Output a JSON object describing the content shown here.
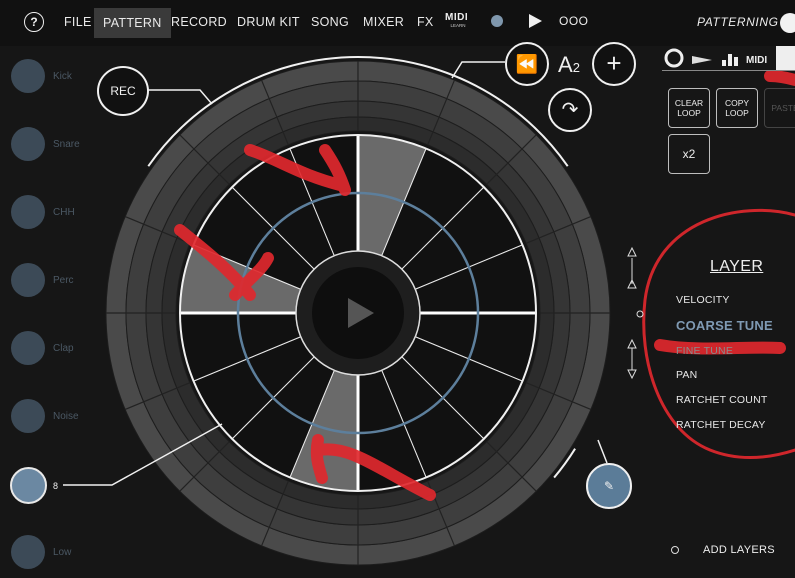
{
  "topbar": {
    "help": "?",
    "menu": [
      "FILE",
      "PATTERN",
      "RECORD",
      "DRUM KIT",
      "SONG",
      "MIXER",
      "FX"
    ],
    "active_menu": "PATTERN",
    "midi_learn_label": "MIDI",
    "midi_learn_sub": "LEARN",
    "more_label": "OOO",
    "app_title": "PATTERNING 2"
  },
  "drums": [
    {
      "label": "Kick"
    },
    {
      "label": "Snare"
    },
    {
      "label": "CHH"
    },
    {
      "label": "Perc"
    },
    {
      "label": "Clap"
    },
    {
      "label": "Noise"
    },
    {
      "label": ""
    },
    {
      "label": "Low"
    }
  ],
  "selected_drum_value": "8",
  "sequencer": {
    "rec_label": "REC",
    "pattern_name": "A",
    "pattern_sub": "2",
    "active_steps": [
      0,
      8,
      12
    ],
    "highlight_step": 11
  },
  "right_panel": {
    "clear_loop": "CLEAR LOOP",
    "copy_loop": "COPY LOOP",
    "paste": "PASTE",
    "x2": "x2",
    "layer_title": "LAYER",
    "layers": [
      "VELOCITY",
      "COARSE TUNE",
      "FINE TUNE",
      "PAN",
      "RATCHET COUNT",
      "RATCHET DECAY"
    ],
    "selected_layer": "COARSE TUNE",
    "add_layers": "ADD LAYERS"
  },
  "colors": {
    "accent": "#7f9ab3",
    "annotation": "#e0282e",
    "drum_pad": "#3c4a57"
  }
}
